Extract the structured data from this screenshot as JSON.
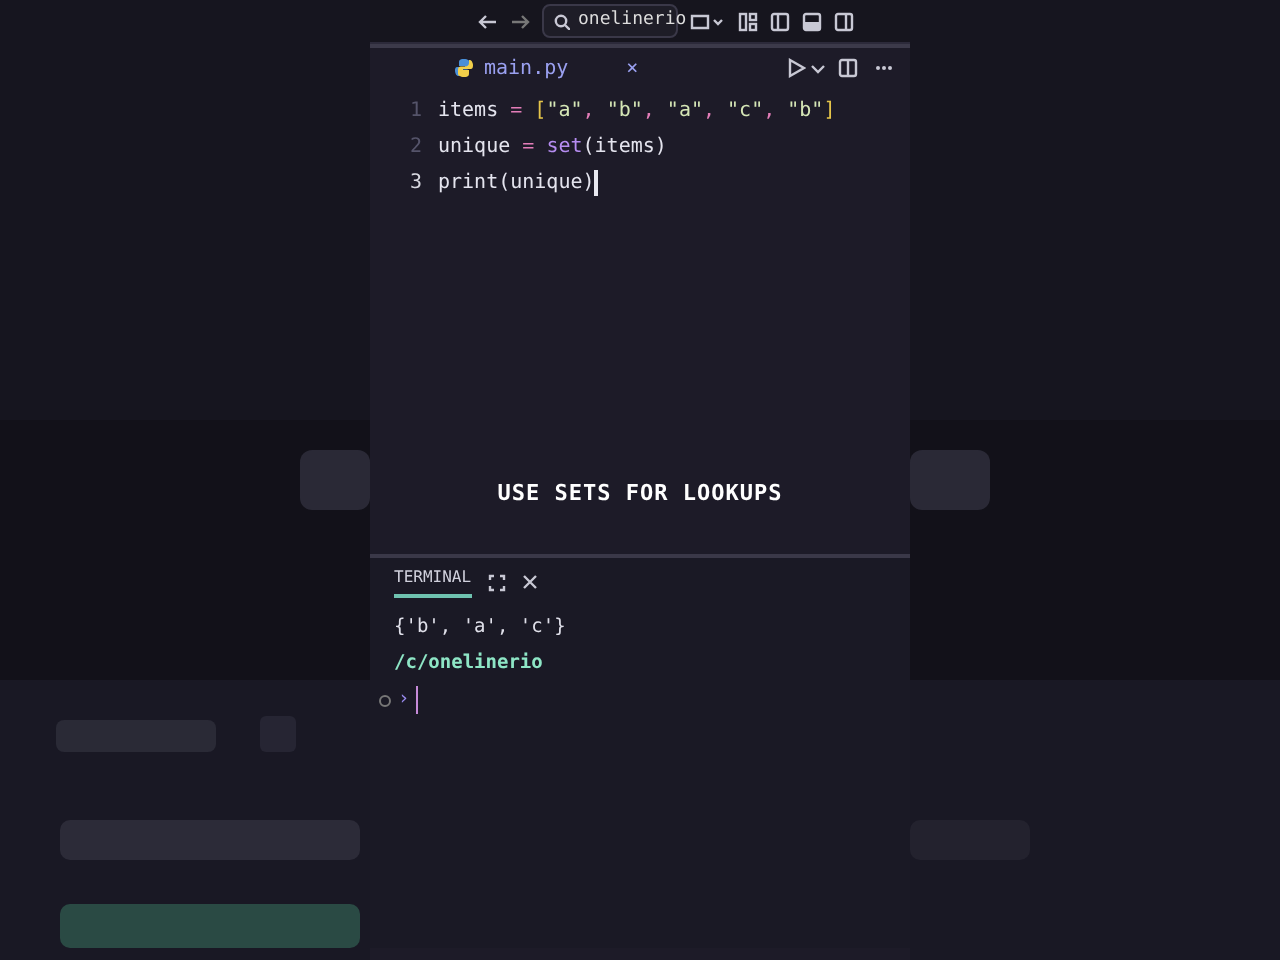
{
  "toolbar": {
    "search": "onelinerio"
  },
  "tabs": [
    {
      "label": "main.py",
      "selected": true,
      "close": "×"
    }
  ],
  "editor": {
    "lines": [
      {
        "number": "1",
        "current": false,
        "tokens": [
          {
            "kind": "name",
            "text": "items "
          },
          {
            "kind": "op",
            "text": "= "
          },
          {
            "kind": "bracket",
            "text": "["
          },
          {
            "kind": "str",
            "text": "\"a\""
          },
          {
            "kind": "op",
            "text": ", "
          },
          {
            "kind": "str",
            "text": "\"b\""
          },
          {
            "kind": "op",
            "text": ", "
          },
          {
            "kind": "str",
            "text": "\"a\""
          },
          {
            "kind": "op",
            "text": ", "
          },
          {
            "kind": "str",
            "text": "\"c\""
          },
          {
            "kind": "op",
            "text": ", "
          },
          {
            "kind": "str",
            "text": "\"b\""
          },
          {
            "kind": "bracket",
            "text": "]"
          }
        ]
      },
      {
        "number": "2",
        "current": false,
        "tokens": [
          {
            "kind": "name",
            "text": "unique "
          },
          {
            "kind": "op",
            "text": "= "
          },
          {
            "kind": "fn",
            "text": "set"
          },
          {
            "kind": "name",
            "text": "(items)"
          }
        ]
      },
      {
        "number": "3",
        "current": true,
        "tokens": [
          {
            "kind": "name",
            "text": "print(unique)"
          }
        ]
      }
    ]
  },
  "caption": "USE SETS FOR LOOKUPS",
  "panel": {
    "tabs": [
      {
        "label": "TERMINAL",
        "selected": true
      }
    ],
    "lines": [
      {
        "kind": "output",
        "text": "{'b', 'a', 'c'}"
      },
      {
        "kind": "path",
        "text": "/c/onelinerio"
      },
      {
        "kind": "prompt",
        "text": "›"
      }
    ]
  }
}
